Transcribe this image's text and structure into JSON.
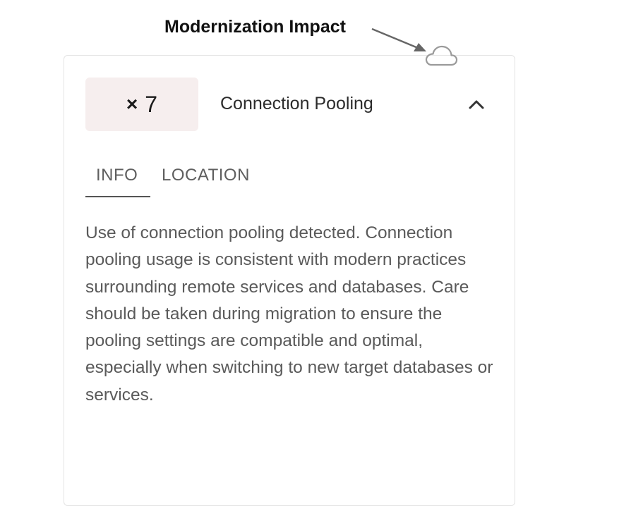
{
  "annotation": {
    "label": "Modernization Impact"
  },
  "finding": {
    "count_symbol": "×",
    "count": "7",
    "title": "Connection Pooling",
    "impact_icon": "cloud-icon",
    "toggle_icon": "chevron-up-icon",
    "expanded": true
  },
  "tabs": [
    {
      "label": "INFO",
      "active": true
    },
    {
      "label": "LOCATION",
      "active": false
    }
  ],
  "description": "Use of connection pooling detected. Connection pooling usage is consistent with modern practices surrounding remote services and databases. Care should be taken during migration to ensure the pooling settings are compatible and optimal, especially when switching to new target databases or services.",
  "colors": {
    "badge_background": "#f6eeee",
    "text_primary": "#2b2b2b",
    "text_secondary": "#5a5a5a",
    "icon_gray": "#9a9a9a"
  }
}
